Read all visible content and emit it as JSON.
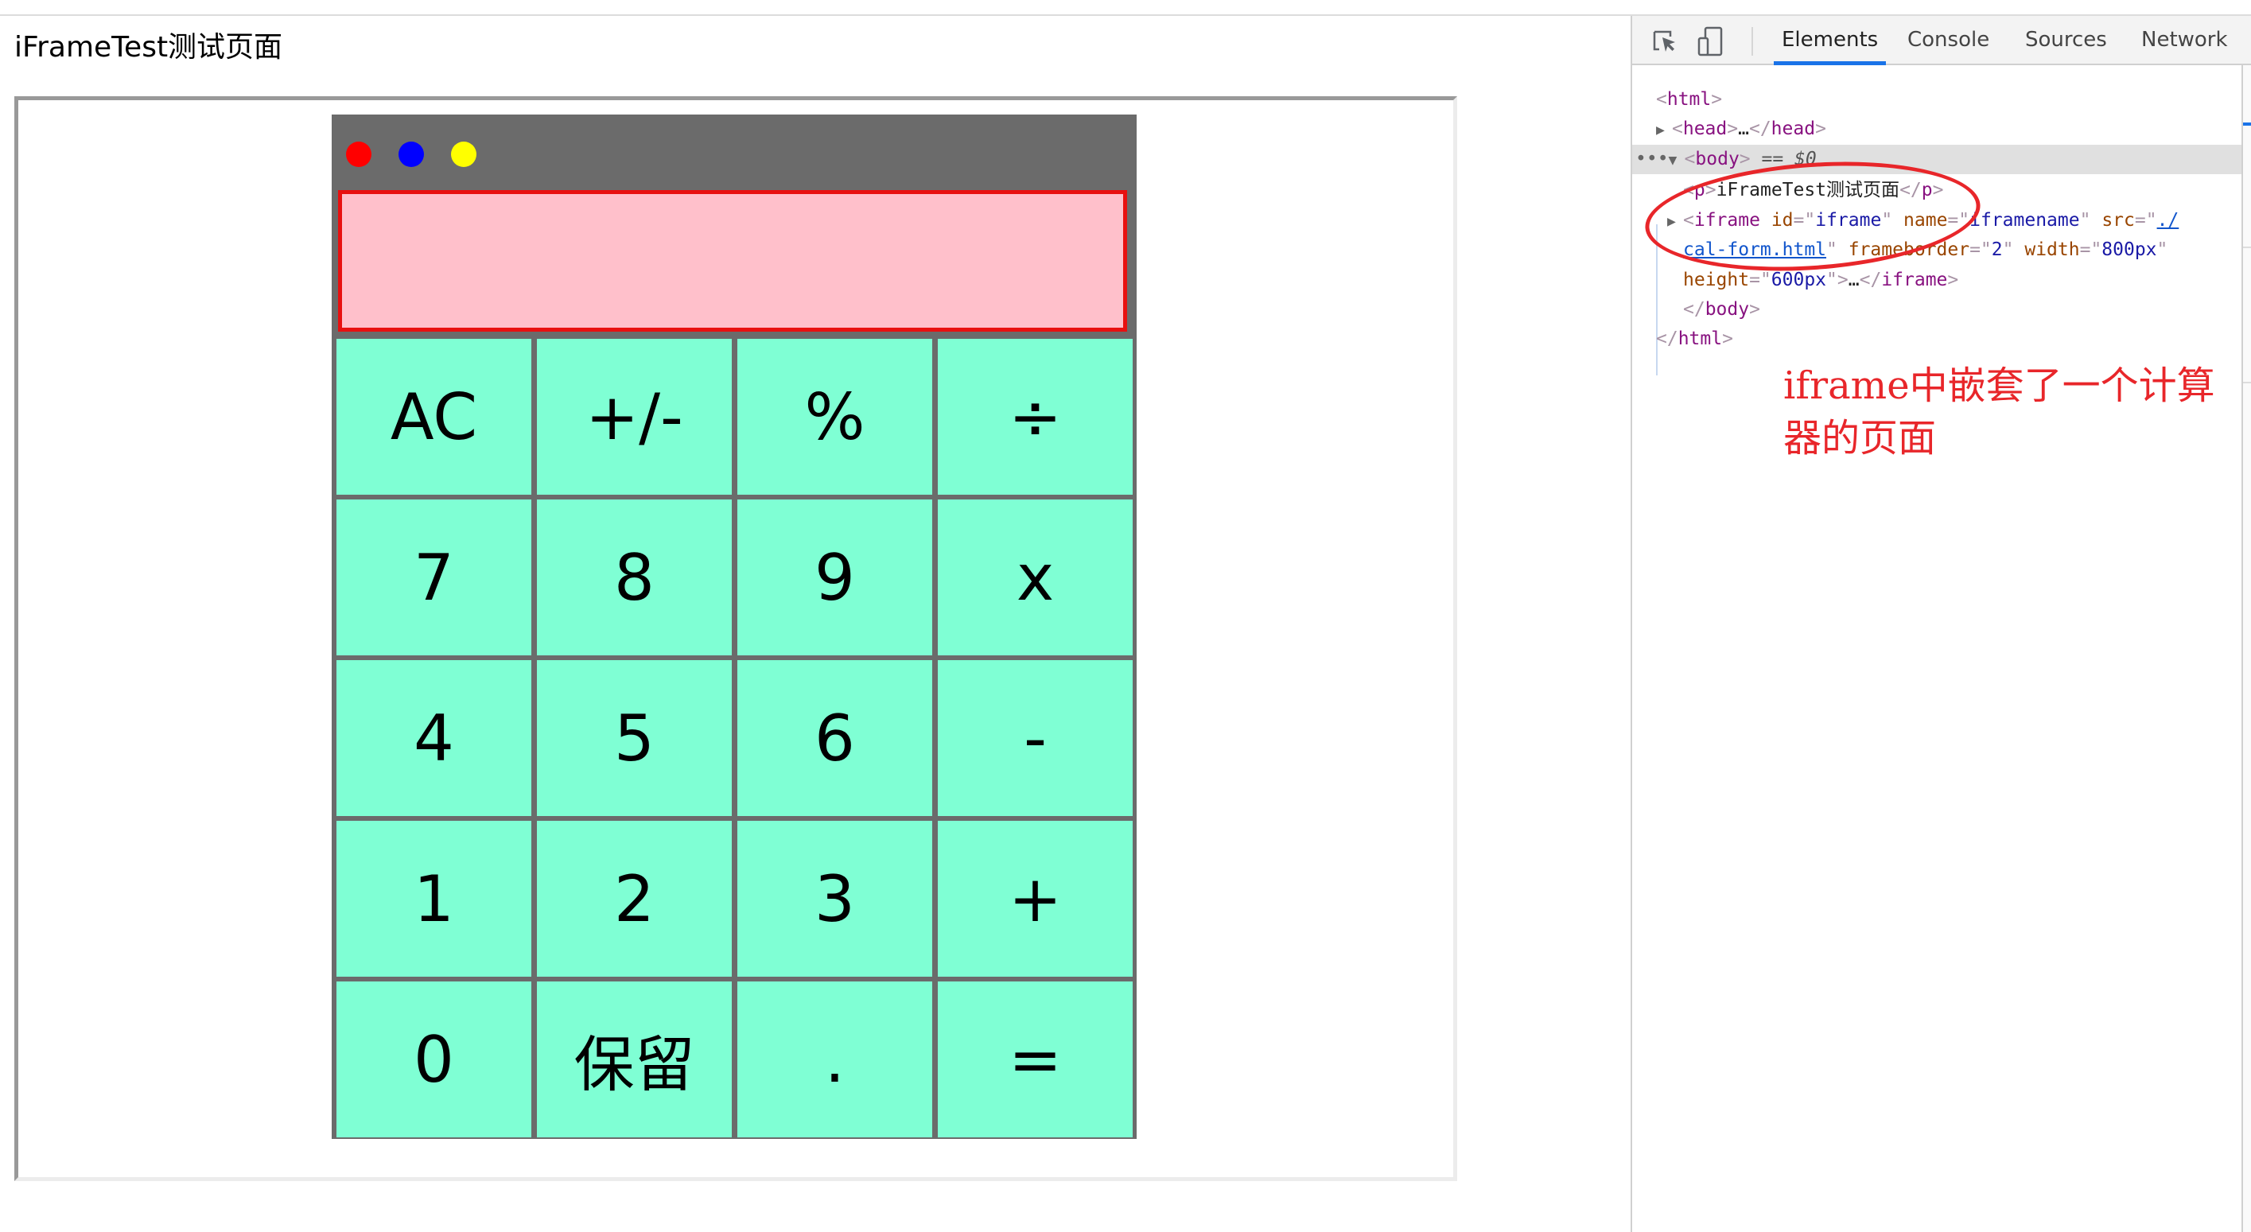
{
  "page": {
    "title": "iFrameTest测试页面"
  },
  "calculator": {
    "display_value": "",
    "window_dots": [
      {
        "name": "red",
        "color": "#ff0000"
      },
      {
        "name": "blue",
        "color": "#0000ff"
      },
      {
        "name": "yellow",
        "color": "#ffff00"
      }
    ],
    "colors": {
      "frame": "#6b6b6b",
      "display_bg": "#ffc0cb",
      "display_border": "#e81010",
      "key_bg": "#7fffd4"
    },
    "keys": [
      {
        "label": "AC",
        "name": "key-ac"
      },
      {
        "label": "+/-",
        "name": "key-toggle-sign"
      },
      {
        "label": "%",
        "name": "key-percent"
      },
      {
        "label": "÷",
        "name": "key-divide"
      },
      {
        "label": "7",
        "name": "key-7"
      },
      {
        "label": "8",
        "name": "key-8"
      },
      {
        "label": "9",
        "name": "key-9"
      },
      {
        "label": "x",
        "name": "key-multiply"
      },
      {
        "label": "4",
        "name": "key-4"
      },
      {
        "label": "5",
        "name": "key-5"
      },
      {
        "label": "6",
        "name": "key-6"
      },
      {
        "label": "-",
        "name": "key-subtract"
      },
      {
        "label": "1",
        "name": "key-1"
      },
      {
        "label": "2",
        "name": "key-2"
      },
      {
        "label": "3",
        "name": "key-3"
      },
      {
        "label": "+",
        "name": "key-add"
      },
      {
        "label": "0",
        "name": "key-0"
      },
      {
        "label": "保留",
        "name": "key-reserved"
      },
      {
        "label": ".",
        "name": "key-decimal"
      },
      {
        "label": "=",
        "name": "key-equals"
      }
    ]
  },
  "devtools": {
    "toolbar": {
      "inspect_icon": "element-picker-icon",
      "device_icon": "device-toolbar-icon"
    },
    "tabs": [
      {
        "label": "Elements",
        "active": true
      },
      {
        "label": "Console",
        "active": false
      },
      {
        "label": "Sources",
        "active": false
      },
      {
        "label": "Network",
        "active": false
      }
    ],
    "tree": {
      "html_open": "html",
      "head_tag": "head",
      "head_ellipsis": "…",
      "body_tag": "body",
      "body_selected_suffix": "== $0",
      "body_dots": "…",
      "p_tag": "p",
      "p_text": "iFrameTest测试页面",
      "iframe_tag": "iframe",
      "iframe_attrs": [
        {
          "name": "id",
          "value": "iframe"
        },
        {
          "name": "name",
          "value": "iframename"
        },
        {
          "name": "src",
          "value": "./cal-form.html"
        },
        {
          "name": "frameborder",
          "value": "2"
        },
        {
          "name": "width",
          "value": "800px"
        },
        {
          "name": "height",
          "value": "600px"
        }
      ],
      "src_part1": "./",
      "src_part2": "cal-form.html",
      "iframe_ellipsis": "…",
      "body_close": "body",
      "html_close": "html"
    }
  },
  "annotation": {
    "text": "iframe中嵌套了一个计算器的页面",
    "color": "#e8262a"
  }
}
